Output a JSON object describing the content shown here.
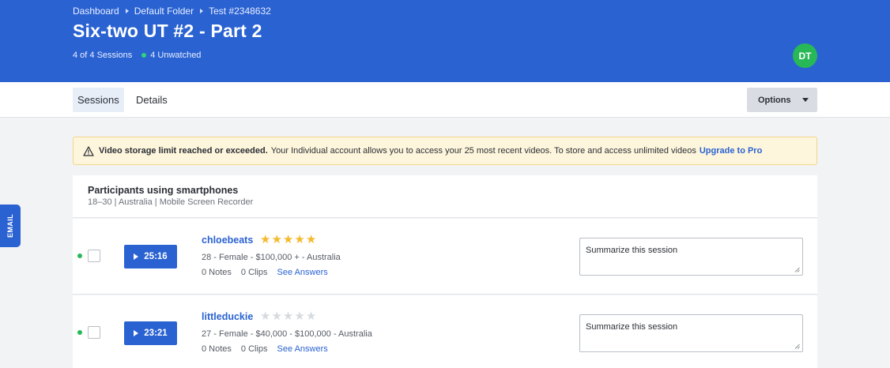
{
  "breadcrumb": [
    "Dashboard",
    "Default Folder",
    "Test #2348632"
  ],
  "page_title": "Six-two UT #2 - Part 2",
  "meta": {
    "sessions": "4 of 4 Sessions",
    "unwatched": "4 Unwatched"
  },
  "user": {
    "initials": "DT"
  },
  "tabs": [
    {
      "label": "Sessions",
      "active": true
    },
    {
      "label": "Details",
      "active": false
    }
  ],
  "options_label": "Options",
  "alert": {
    "title": "Video storage limit reached or exceeded.",
    "body": "Your Individual account allows you to access your 25 most recent videos. To store and access unlimited videos",
    "link": "Upgrade to Pro"
  },
  "group": {
    "title": "Participants using smartphones",
    "subtitle": "18–30 | Australia | Mobile Screen Recorder"
  },
  "sessions": [
    {
      "duration": "25:16",
      "name": "chloebeats",
      "rating": 5,
      "demographics": "28 - Female - $100,000 + - Australia",
      "notes": "0 Notes",
      "clips": "0 Clips",
      "answers_link": "See Answers",
      "summary_text": "Summarize this session"
    },
    {
      "duration": "23:21",
      "name": "littleduckie",
      "rating": 0,
      "demographics": "27 - Female - $40,000 - $100,000 - Australia",
      "notes": "0 Notes",
      "clips": "0 Clips",
      "answers_link": "See Answers",
      "summary_text": "Summarize this session"
    }
  ],
  "side_tab": "EMAIL",
  "colors": {
    "brand": "#2a62d2",
    "success": "#28b857",
    "star": "#f5b92c",
    "alert_bg": "#fef6dc"
  }
}
